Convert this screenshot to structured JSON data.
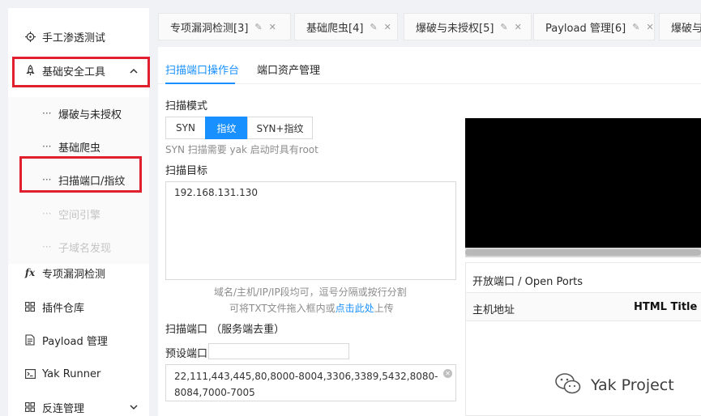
{
  "sidebar": {
    "items": [
      {
        "label": "手工渗透测试",
        "icon": "crosshair-icon"
      },
      {
        "label": "基础安全工具",
        "icon": "rocket-icon",
        "expanded": true
      },
      {
        "label": "专项漏洞检测",
        "icon": "function-icon"
      },
      {
        "label": "插件仓库",
        "icon": "grid-icon"
      },
      {
        "label": "Payload 管理",
        "icon": "document-icon"
      },
      {
        "label": "Yak Runner",
        "icon": "terminal-icon"
      },
      {
        "label": "反连管理",
        "icon": "grid-icon"
      }
    ],
    "subitems": [
      {
        "label": "爆破与未授权",
        "disabled": false
      },
      {
        "label": "基础爬虫",
        "disabled": false
      },
      {
        "label": "扫描端口/指纹",
        "disabled": false
      },
      {
        "label": "空间引擎",
        "disabled": true
      },
      {
        "label": "子域名发现",
        "disabled": true
      }
    ],
    "dots": "···"
  },
  "tabs": [
    {
      "label": "专项漏洞检测[3]"
    },
    {
      "label": "基础爬虫[4]"
    },
    {
      "label": "爆破与未授权[5]"
    },
    {
      "label": "Payload 管理[6]"
    },
    {
      "label": "爆破与"
    }
  ],
  "subtabs": {
    "active": "扫描端口操作台",
    "other": "端口资产管理"
  },
  "form": {
    "scan_mode_label": "扫描模式",
    "modes": [
      "SYN",
      "指纹",
      "SYN+指纹"
    ],
    "selected_mode": "指纹",
    "syn_hint": "SYN 扫描需要 yak 启动时具有root",
    "target_label": "扫描目标",
    "target_value": "192.168.131.130",
    "target_hint_1": "域名/主机/IP/IP段均可，逗号分隔或按行分割",
    "target_hint_2a": "可将TXT文件拖入框内或",
    "target_hint_2_link": "点击此处",
    "target_hint_2b": "上传",
    "ports_label": "扫描端口 （服务端去重）",
    "preset_label": "预设端口",
    "preset_value": "",
    "ports_value": "22,111,443,445,80,8000-8004,3306,3389,5432,8080-8084,7000-7005"
  },
  "open_ports": {
    "title": "开放端口 / Open Ports",
    "columns": [
      "主机地址",
      "HTML Title"
    ]
  },
  "watermark": "Yak Project",
  "colors": {
    "accent": "#1890ff",
    "highlight": "#e0202e"
  }
}
